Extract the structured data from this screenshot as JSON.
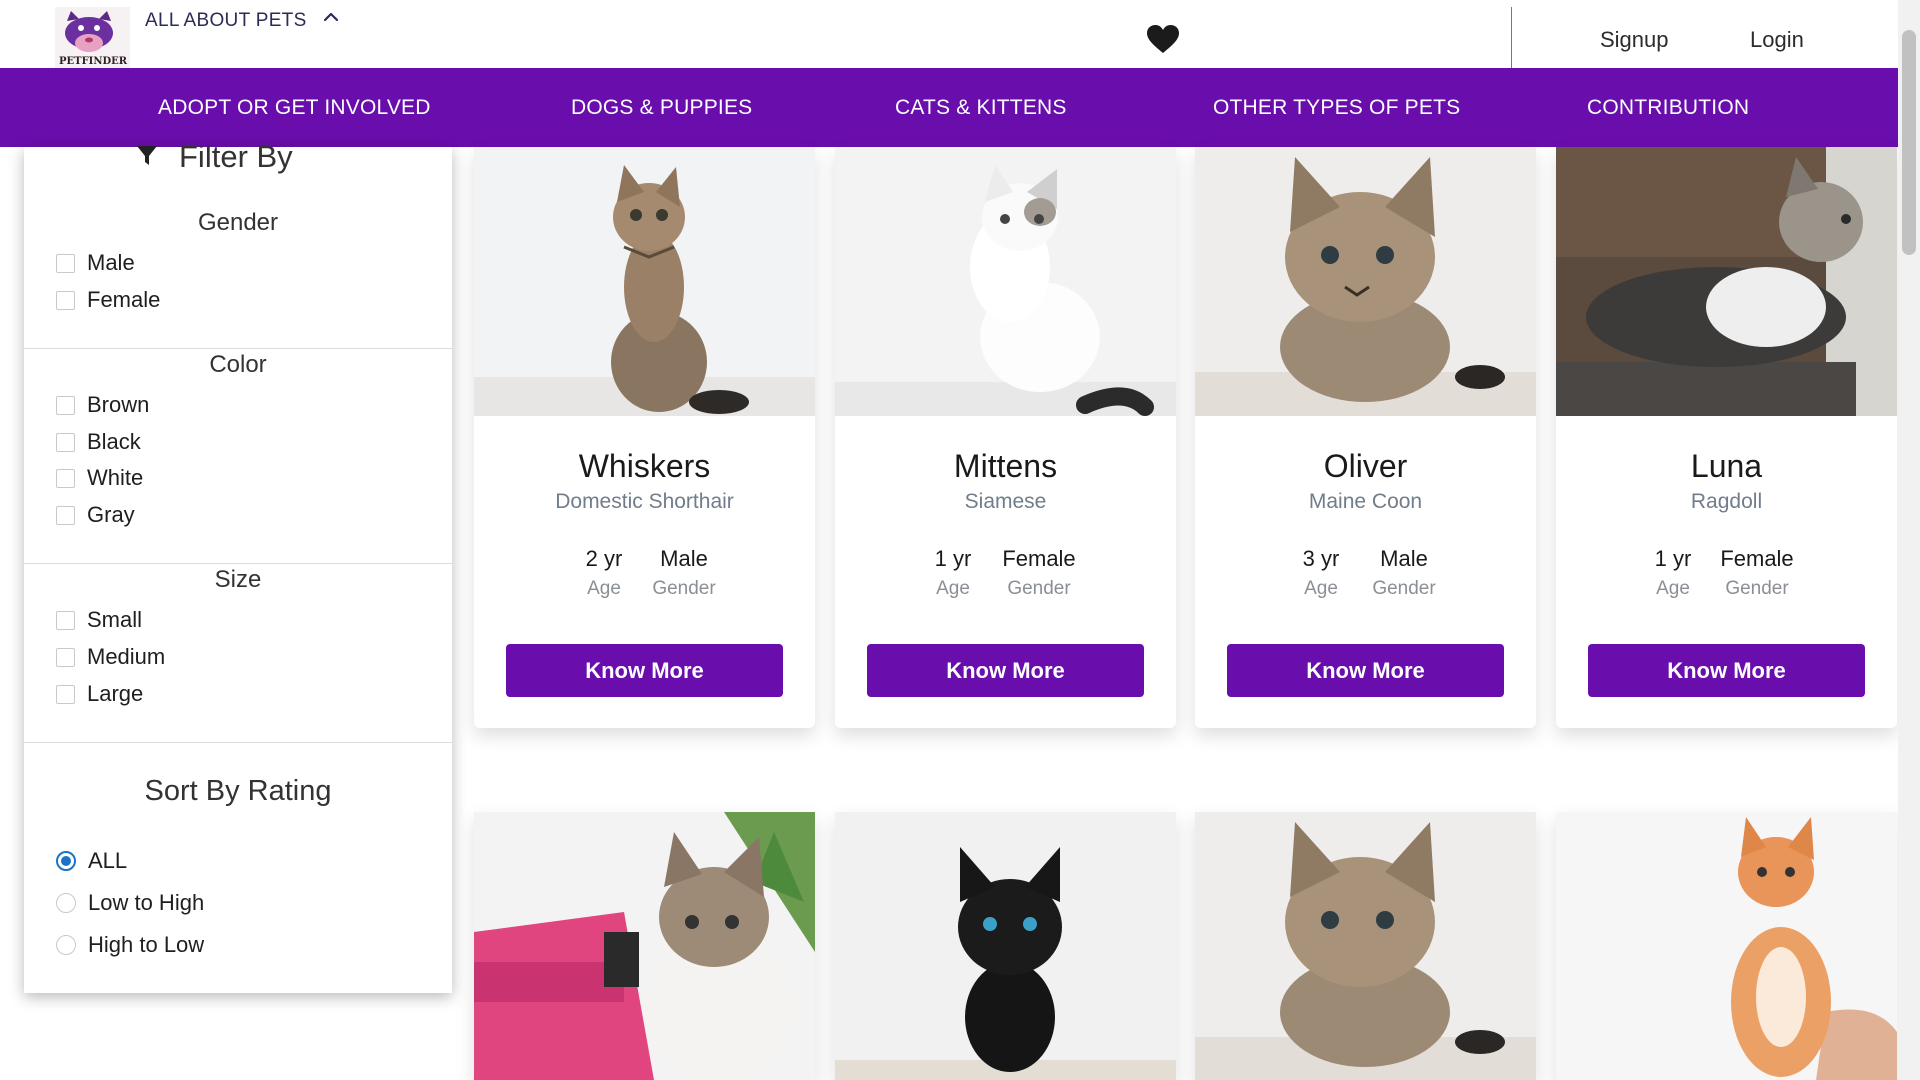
{
  "header": {
    "logo_text": "PETFINDER",
    "brand": "ALL ABOUT PETS",
    "signup": "Signup",
    "login": "Login"
  },
  "nav": {
    "items": [
      {
        "label": "ADOPT OR GET INVOLVED"
      },
      {
        "label": "DOGS & PUPPIES"
      },
      {
        "label": "CATS & KITTENS"
      },
      {
        "label": "OTHER TYPES OF PETS"
      },
      {
        "label": "CONTRIBUTION"
      }
    ]
  },
  "colors": {
    "brand_purple": "#6a0dad",
    "radio_selected": "#1a73c8",
    "breed_text": "#717d8a"
  },
  "filters": {
    "title": "Filter By",
    "gender": {
      "title": "Gender",
      "options": [
        "Male",
        "Female"
      ]
    },
    "color": {
      "title": "Color",
      "options": [
        "Brown",
        "Black",
        "White",
        "Gray"
      ]
    },
    "size": {
      "title": "Size",
      "options": [
        "Small",
        "Medium",
        "Large"
      ]
    },
    "sort": {
      "title": "Sort By Rating",
      "options": [
        "ALL",
        "Low to High",
        "High to Low"
      ],
      "selected": "ALL"
    }
  },
  "cards": [
    {
      "name": "Whiskers",
      "breed": "Domestic Shorthair",
      "age": "2 yr",
      "age_label": "Age",
      "gender": "Male",
      "gender_label": "Gender",
      "button": "Know More"
    },
    {
      "name": "Mittens",
      "breed": "Siamese",
      "age": "1 yr",
      "age_label": "Age",
      "gender": "Female",
      "gender_label": "Gender",
      "button": "Know More"
    },
    {
      "name": "Oliver",
      "breed": "Maine Coon",
      "age": "3 yr",
      "age_label": "Age",
      "gender": "Male",
      "gender_label": "Gender",
      "button": "Know More"
    },
    {
      "name": "Luna",
      "breed": "Ragdoll",
      "age": "1 yr",
      "age_label": "Age",
      "gender": "Female",
      "gender_label": "Gender",
      "button": "Know More"
    }
  ]
}
